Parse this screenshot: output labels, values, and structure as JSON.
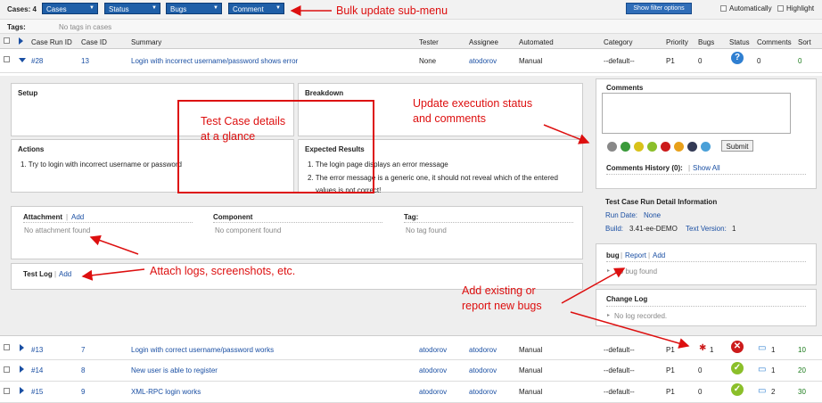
{
  "toolbar": {
    "cases_count": "Cases: 4",
    "menus": [
      "Cases",
      "Status",
      "Bugs",
      "Comment"
    ],
    "show_filter": "Show filter options",
    "automatically": "Automatically",
    "highlight": "Highlight"
  },
  "tags": {
    "label": "Tags:",
    "value": "No tags in cases"
  },
  "headers": [
    "Case Run ID",
    "Case ID",
    "Summary",
    "Tester",
    "Assignee",
    "Automated",
    "Category",
    "Priority",
    "Bugs",
    "Status",
    "Comments",
    "Sort"
  ],
  "rows": [
    {
      "run_id": "#28",
      "case_id": "13",
      "summary": "Login with incorrect username/password shows error",
      "tester": "None",
      "assignee": "atodorov",
      "automated": "Manual",
      "category": "--default--",
      "priority": "P1",
      "bugs": "0",
      "status": "idle",
      "comments": "0",
      "sort": "0"
    },
    {
      "run_id": "#13",
      "case_id": "7",
      "summary": "Login with correct username/password works",
      "tester": "atodorov",
      "assignee": "atodorov",
      "automated": "Manual",
      "category": "--default--",
      "priority": "P1",
      "bugs": "1",
      "status": "failed",
      "comments": "1",
      "sort": "10"
    },
    {
      "run_id": "#14",
      "case_id": "8",
      "summary": "New user is able to register",
      "tester": "atodorov",
      "assignee": "atodorov",
      "automated": "Manual",
      "category": "--default--",
      "priority": "P1",
      "bugs": "0",
      "status": "passed",
      "comments": "1",
      "sort": "20"
    },
    {
      "run_id": "#15",
      "case_id": "9",
      "summary": "XML-RPC login works",
      "tester": "atodorov",
      "assignee": "atodorov",
      "automated": "Manual",
      "category": "--default--",
      "priority": "P1",
      "bugs": "0",
      "status": "passed",
      "comments": "2",
      "sort": "30"
    }
  ],
  "details": {
    "setup": "Setup",
    "breakdown": "Breakdown",
    "actions": "Actions",
    "action_item": "1. Try to login with incorrect username or password",
    "expected": "Expected Results",
    "expected_1": "1. The login page displays an error message",
    "expected_2": "2. The error message is a generic one, it should not reveal which of the entered",
    "expected_2b": "values is not correct!",
    "attachment": "Attachment",
    "add": "Add",
    "no_attachment": "No attachment found",
    "component": "Component",
    "no_component": "No component found",
    "tag": "Tag:",
    "no_tag": "No tag found",
    "test_log": "Test Log"
  },
  "side": {
    "comments": "Comments",
    "submit": "Submit",
    "history": "Comments History (0):",
    "show_all": "Show All",
    "run_detail": "Test Case Run Detail Information",
    "run_date_label": "Run Date:",
    "run_date": "None",
    "build_label": "Build:",
    "build": "3.41-ee-DEMO",
    "text_version_label": "Text Version:",
    "text_version": "1",
    "bug": "bug",
    "report": "Report",
    "add": "Add",
    "no_bug": "No bug found",
    "change_log": "Change Log",
    "no_log": "No log recorded."
  },
  "annotations": {
    "bulk": "Bulk update sub-menu",
    "details1": "Test Case details",
    "details2": "at a glance",
    "update1": "Update execution status",
    "update2": "and comments",
    "attach": "Attach logs, screenshots, etc.",
    "bugs1": "Add existing or",
    "bugs2": "report new bugs"
  },
  "colors": {
    "link": "#1a4fa3",
    "annotation": "#dd0f0f",
    "passed": "#8bbf2a",
    "failed": "#cc1b1b",
    "idle": "#2f7fd1"
  }
}
